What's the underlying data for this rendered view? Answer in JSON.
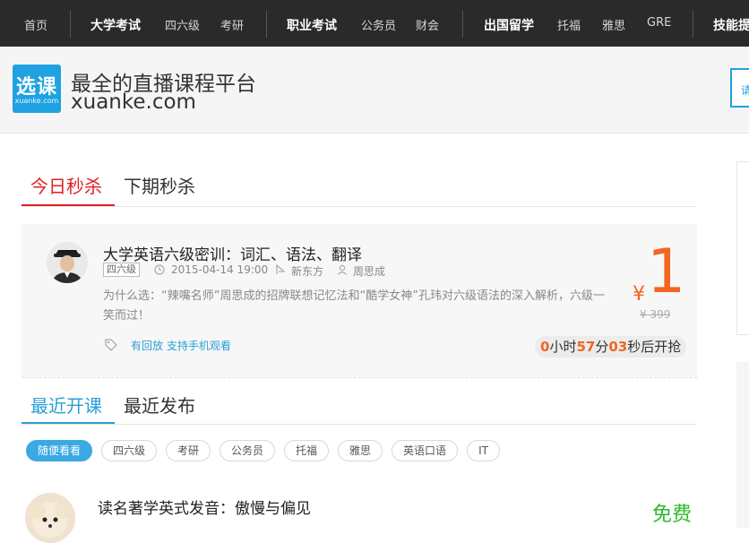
{
  "topnav": {
    "items": [
      {
        "label": "首页",
        "type": "link"
      },
      {
        "label": "大学考试",
        "type": "cat"
      },
      {
        "label": "四六级",
        "type": "link"
      },
      {
        "label": "考研",
        "type": "link"
      },
      {
        "label": "职业考试",
        "type": "cat"
      },
      {
        "label": "公务员",
        "type": "link"
      },
      {
        "label": "财会",
        "type": "link"
      },
      {
        "label": "出国留学",
        "type": "cat"
      },
      {
        "label": "托福",
        "type": "link"
      },
      {
        "label": "雅思",
        "type": "link"
      },
      {
        "label": "GRE",
        "type": "link"
      },
      {
        "label": "技能提",
        "type": "cat"
      }
    ]
  },
  "header": {
    "logo_text": "选课",
    "logo_sub": "xuanke.com",
    "slogan": "最全的直播课程平台",
    "domain": "xuanke.com",
    "right_button": "请"
  },
  "seckill": {
    "tabs": [
      {
        "label": "今日秒杀",
        "active": true
      },
      {
        "label": "下期秒杀",
        "active": false
      }
    ],
    "course": {
      "title": "大学英语六级密训：词汇、语法、翻译",
      "level": "四六级",
      "time": "2015-04-14 19:00",
      "school": "新东方",
      "teacher": "周思成",
      "description": "为什么选：“辣嘴名师”周思成的招牌联想记忆法和“酷学女神”孔玮对六级语法的深入解析，六级一笑而过！",
      "tags": "有回放 支持手机观看",
      "price_symbol": "¥",
      "price": "1",
      "original_price": "¥ 399",
      "countdown": {
        "hours": "0",
        "hours_unit": "小时",
        "minutes": "57",
        "minutes_unit": "分",
        "seconds": "03",
        "seconds_unit": "秒后开抢"
      }
    }
  },
  "recent": {
    "tabs": [
      {
        "label": "最近开课",
        "active": true
      },
      {
        "label": "最近发布",
        "active": false
      }
    ],
    "filters": [
      "随便看看",
      "四六级",
      "考研",
      "公务员",
      "托福",
      "雅思",
      "英语口语",
      "IT"
    ],
    "first_course": {
      "title": "读名著学英式发音：傲慢与偏见",
      "price": "免费"
    }
  },
  "colors": {
    "accent_red": "#e02020",
    "accent_blue": "#2a9fd6",
    "price_orange": "#f26522",
    "free_green": "#2eb82e",
    "nav_bg": "#2a2a2a"
  }
}
